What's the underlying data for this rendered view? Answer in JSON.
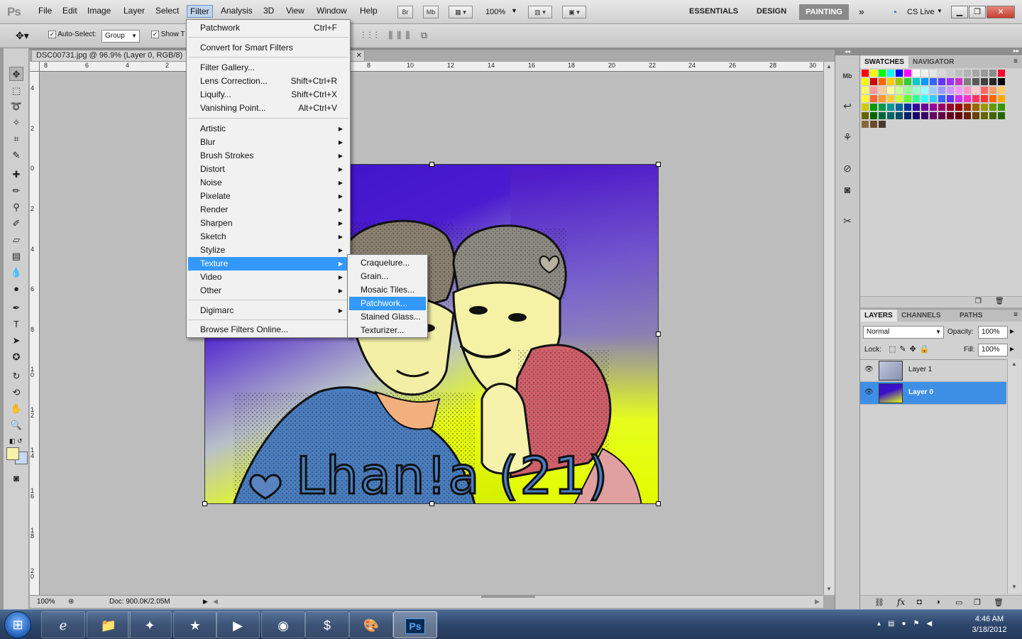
{
  "menubar": {
    "logo": "Ps",
    "items": [
      "File",
      "Edit",
      "Image",
      "Layer",
      "Select",
      "Filter",
      "Analysis",
      "3D",
      "View",
      "Window",
      "Help"
    ],
    "bridge": "Br",
    "minibridge": "Mb",
    "zoom": "100%",
    "workspaces": [
      "ESSENTIALS",
      "DESIGN",
      "PAINTING"
    ],
    "cs_live": "CS Live"
  },
  "options": {
    "auto_select_label": "Auto-Select:",
    "auto_select_value": "Group",
    "show_label": "Show T"
  },
  "document": {
    "tab_title": "DSC00731.jpg @ 96.9% (Layer 0, RGB/8)",
    "ruler_h": [
      "8",
      "6",
      "4",
      "2",
      "8",
      "10",
      "12",
      "14",
      "16",
      "18",
      "20",
      "22",
      "24",
      "26",
      "28",
      "30"
    ],
    "ruler_v": [
      "4",
      "2",
      "0",
      "2",
      "4",
      "6",
      "8",
      "1 0",
      "1 2",
      "1 4",
      "1 6",
      "1 8",
      "2 0"
    ],
    "zoom_status": "100%",
    "doc_size": "Doc: 900.0K/2.05M",
    "artwork_text": "Lhan!a (21)"
  },
  "filter_menu": {
    "top": [
      {
        "label": "Patchwork",
        "shortcut": "Ctrl+F"
      },
      {
        "label": "Convert for Smart Filters",
        "shortcut": ""
      }
    ],
    "gallery": [
      {
        "label": "Filter Gallery...",
        "shortcut": ""
      },
      {
        "label": "Lens Correction...",
        "shortcut": "Shift+Ctrl+R"
      },
      {
        "label": "Liquify...",
        "shortcut": "Shift+Ctrl+X"
      },
      {
        "label": "Vanishing Point...",
        "shortcut": "Alt+Ctrl+V"
      }
    ],
    "groups": [
      "Artistic",
      "Blur",
      "Brush Strokes",
      "Distort",
      "Noise",
      "Pixelate",
      "Render",
      "Sharpen",
      "Sketch",
      "Stylize",
      "Texture",
      "Video",
      "Other"
    ],
    "digimarc": "Digimarc",
    "browse": "Browse Filters Online..."
  },
  "texture_submenu": [
    "Craquelure...",
    "Grain...",
    "Mosaic Tiles...",
    "Patchwork...",
    "Stained Glass...",
    "Texturizer..."
  ],
  "swatches_panel": {
    "tabs": [
      "SWATCHES",
      "NAVIGATOR"
    ]
  },
  "layers_panel": {
    "tabs": [
      "LAYERS",
      "CHANNELS",
      "PATHS"
    ],
    "blend_mode": "Normal",
    "opacity_label": "Opacity:",
    "opacity": "100%",
    "lock_label": "Lock:",
    "fill_label": "Fill:",
    "fill": "100%",
    "layers": [
      "Layer 1",
      "Layer 0"
    ]
  },
  "taskbar": {
    "time": "4:46 AM",
    "date": "3/18/2012"
  },
  "colors": {
    "accent": "#3399ff",
    "foreground": "#f6f3a6",
    "background": "#c8d8f0"
  }
}
